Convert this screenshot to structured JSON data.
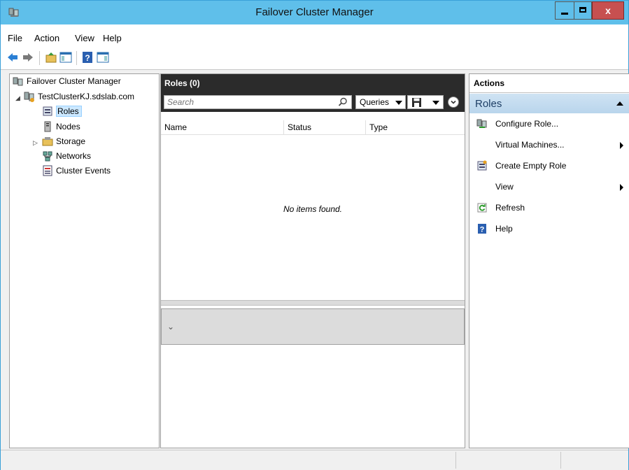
{
  "window": {
    "title": "Failover Cluster Manager",
    "accent": "#5fbfea",
    "close_color": "#c75050",
    "close_glyph": "x"
  },
  "menu": [
    "File",
    "Action",
    "View",
    "Help"
  ],
  "toolbar": {
    "icons": [
      "back-arrow-icon",
      "forward-arrow-icon",
      "up-folder-icon",
      "show-hide-console-tree-icon",
      "help-icon",
      "show-hide-action-pane-icon"
    ]
  },
  "tree": {
    "root": "Failover Cluster Manager",
    "cluster": "TestClusterKJ.sdslab.com",
    "children": [
      "Roles",
      "Nodes",
      "Storage",
      "Networks",
      "Cluster Events"
    ],
    "selected": "Roles"
  },
  "center": {
    "header": "Roles (0)",
    "search_placeholder": "Search",
    "queries_label": "Queries",
    "columns": [
      "Name",
      "Status",
      "Type"
    ],
    "empty_message": "No items found."
  },
  "actions": {
    "title": "Actions",
    "section": "Roles",
    "items": [
      {
        "label": "Configure Role...",
        "icon": "configure-role-icon",
        "submenu": false
      },
      {
        "label": "Virtual Machines...",
        "icon": "",
        "submenu": true
      },
      {
        "label": "Create Empty Role",
        "icon": "create-empty-role-icon",
        "submenu": false
      },
      {
        "label": "View",
        "icon": "",
        "submenu": true
      },
      {
        "label": "Refresh",
        "icon": "refresh-icon",
        "submenu": false
      },
      {
        "label": "Help",
        "icon": "help-icon",
        "submenu": false
      }
    ]
  }
}
